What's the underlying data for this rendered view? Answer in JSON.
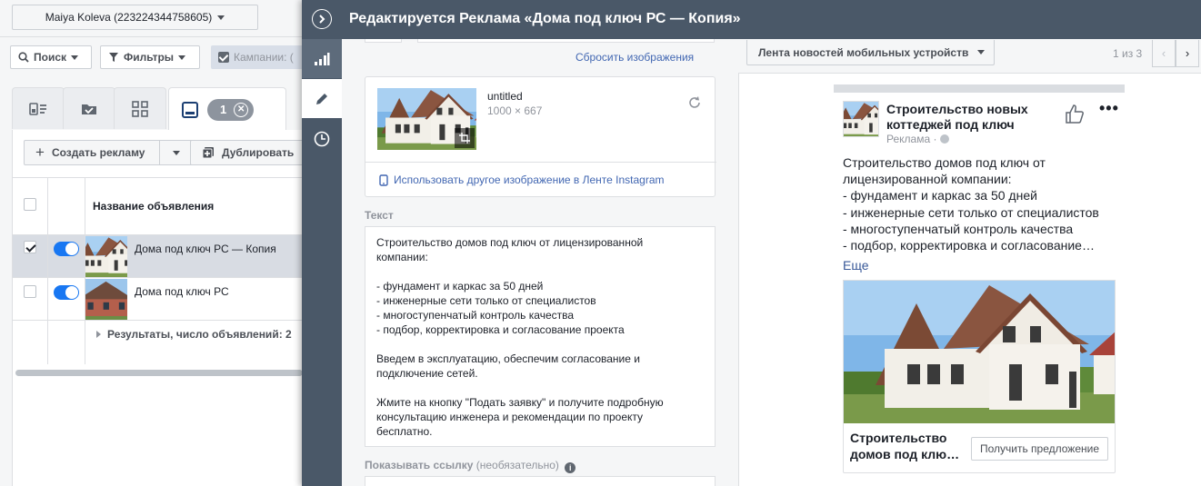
{
  "account": {
    "name": "Maiya Koleva (223224344758605)"
  },
  "toolbar": {
    "search": "Поиск",
    "filters": "Фильтры",
    "campaigns_chip": "Кампании: ("
  },
  "tabs": {
    "selected_count": "1"
  },
  "actions": {
    "create_ad": "Создать рекламу",
    "duplicate": "Дублировать"
  },
  "table": {
    "column_name": "Название объявления",
    "rows": [
      {
        "name": "Дома под ключ РС — Копия",
        "selected": true,
        "active": true
      },
      {
        "name": "Дома под ключ РС",
        "selected": false,
        "active": true
      }
    ],
    "results": "Результаты, число объявлений: 2"
  },
  "editor": {
    "title": "Редактируется Реклама «Дома под ключ РС — Копия»",
    "reset_images": "Сбросить изображения",
    "image": {
      "name": "untitled",
      "dims": "1000 × 667"
    },
    "instagram_link": "Использовать другое изображение в Ленте Instagram",
    "text_label": "Текст",
    "text_value": "Строительство домов под ключ от лицензированной\nкомпании:\n\n- фундамент и каркас за 50 дней\n- инженерные сети только от специалистов\n- многоступенчатый контроль качества\n- подбор, корректировка и согласование проекта\n\nВведем в эксплуатацию, обеспечим согласование и\nподключение сетей.\n\nЖмите на кнопку \"Подать заявку\" и получите подробную\nконсультацию инженера и рекомендации по проекту\nбесплатно.",
    "show_link_label": "Показывать ссылку",
    "show_link_optional": "(необязательно)"
  },
  "preview": {
    "placement": "Лента новостей мобильных устройств",
    "pager": "1 из 3",
    "page_name": "Строительство новых коттеджей под ключ",
    "sponsored": "Реклама ·",
    "post_text": "Строительство домов под ключ от\nлицензированной компании:\n- фундамент и каркас за 50 дней\n- инженерные сети только от специалистов\n- многоступенчатый контроль качества\n- подбор, корректировка и согласование…",
    "more": "Еще",
    "headline": "Строительство домов под клю…",
    "cta": "Получить предложение"
  },
  "colors": {
    "header": "#4a5868",
    "toggle": "#1877f2",
    "link": "#4267b2",
    "selected_row": "#d8dce3"
  },
  "icons": [
    "search-icon",
    "filter-icon",
    "checkbox-icon",
    "plus-icon",
    "duplicate-icon",
    "chevron-right-icon",
    "bar-chart-icon",
    "pencil-icon",
    "clock-icon",
    "refresh-icon",
    "crop-icon",
    "mobile-icon",
    "info-icon",
    "like-icon",
    "more-dots-icon",
    "globe-icon"
  ]
}
